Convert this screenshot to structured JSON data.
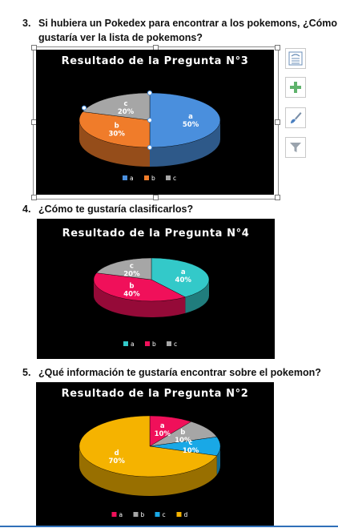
{
  "questions": [
    {
      "number": "3.",
      "line1": "Si hubiera un Pokedex para encontrar a los pokemons, ¿Cómo te",
      "line2": "gustaría ver la lista de pokemons?"
    },
    {
      "number": "4.",
      "line1": "¿Cómo te gustaría clasificarlos?"
    },
    {
      "number": "5.",
      "line1": "¿Qué información te gustaría encontrar sobre el pokemon?"
    }
  ],
  "chart_data": [
    {
      "type": "pie",
      "title": "Resultado de la Pregunta N°3",
      "categories": [
        "a",
        "b",
        "c"
      ],
      "values": [
        50,
        30,
        20
      ],
      "labels": [
        "50%",
        "30%",
        "20%"
      ],
      "colors": [
        "#4a8fdd",
        "#f07c2a",
        "#a6a6a6"
      ],
      "legend_position": "bottom"
    },
    {
      "type": "pie",
      "title": "Resultado de la Pregunta N°4",
      "categories": [
        "a",
        "b",
        "c"
      ],
      "values": [
        40,
        40,
        20
      ],
      "labels": [
        "40%",
        "40%",
        "20%"
      ],
      "colors": [
        "#33c9c9",
        "#f0105a",
        "#a6a6a6"
      ],
      "legend_position": "bottom"
    },
    {
      "type": "pie",
      "title": "Resultado de la Pregunta N°2",
      "categories": [
        "a",
        "b",
        "c",
        "d"
      ],
      "values": [
        10,
        10,
        10,
        70
      ],
      "labels": [
        "10%",
        "10%",
        "10%",
        "70%"
      ],
      "colors": [
        "#f0105a",
        "#a6a6a6",
        "#19a8e6",
        "#f5b300"
      ],
      "legend_position": "bottom"
    }
  ],
  "tools": [
    "layout-options-icon",
    "plus-icon",
    "brush-icon",
    "filter-icon"
  ]
}
